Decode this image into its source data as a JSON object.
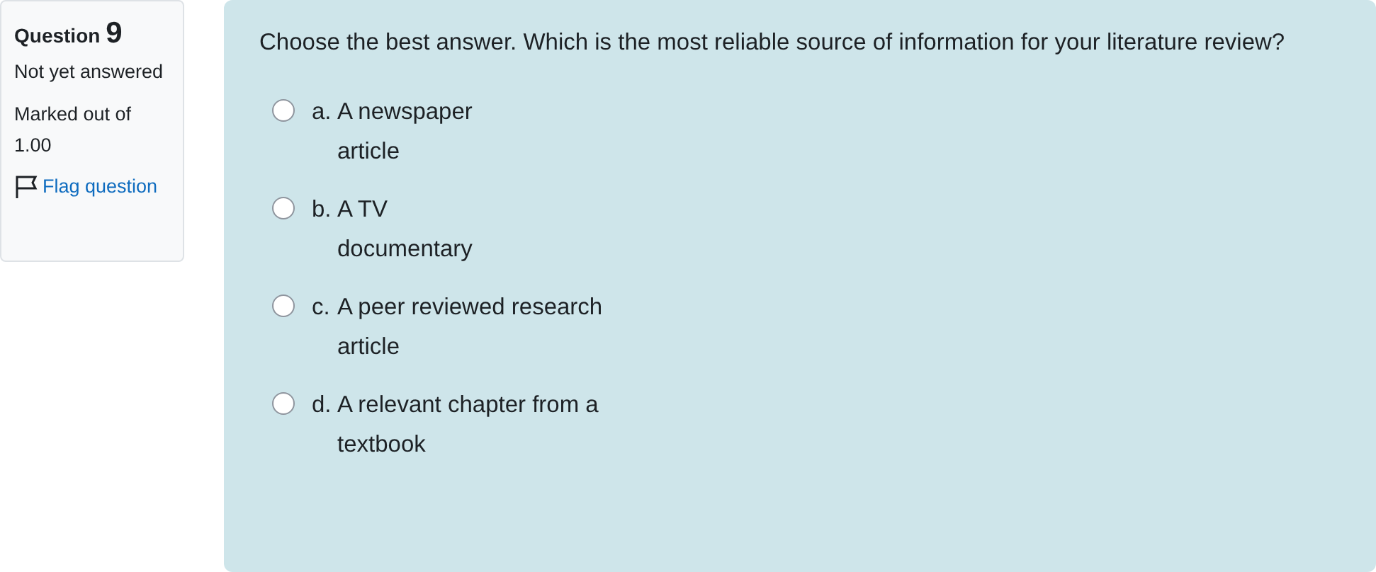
{
  "info": {
    "label": "Question",
    "number": "9",
    "status": "Not yet answered",
    "marks": "Marked out of 1.00",
    "flag": {
      "label": "Flag question",
      "flagged": false
    }
  },
  "question": {
    "text": "Choose the best answer. Which is the most reliable source of information for your literature review?",
    "options": [
      {
        "letter": "a.",
        "text": "A newspaper\narticle",
        "selected": false
      },
      {
        "letter": "b.",
        "text": "A TV\ndocumentary",
        "selected": false
      },
      {
        "letter": "c.",
        "text": "A peer reviewed research\narticle",
        "selected": false
      },
      {
        "letter": "d.",
        "text": "A relevant chapter from a\ntextbook",
        "selected": false
      }
    ]
  }
}
